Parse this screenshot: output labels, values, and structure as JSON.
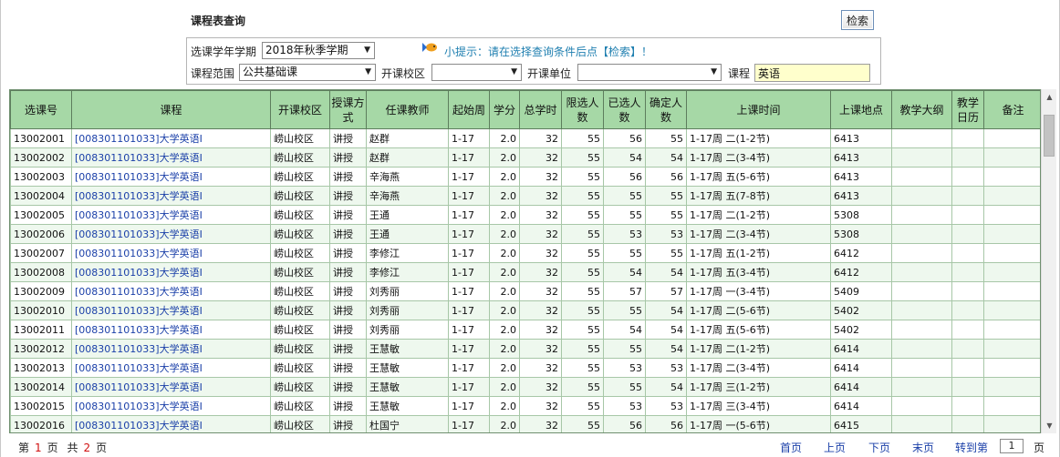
{
  "page": {
    "title": "课程表查询",
    "search_label": "检索"
  },
  "filters": {
    "term_label": "选课学年学期",
    "term_value": "2018年秋季学期",
    "tip": "小提示：请在选择查询条件后点【检索】！",
    "scope_label": "课程范围",
    "scope_value": "公共基础课",
    "campus_label": "开课校区",
    "campus_value": "",
    "unit_label": "开课单位",
    "unit_value": "",
    "course_label": "课程",
    "course_value": "英语"
  },
  "table": {
    "headers": [
      "选课号",
      "课程",
      "开课校区",
      "授课方式",
      "任课教师",
      "起始周",
      "学分",
      "总学时",
      "限选人数",
      "已选人数",
      "确定人数",
      "上课时间",
      "上课地点",
      "教学大纲",
      "教学日历",
      "备注"
    ],
    "rows": [
      [
        "13002001",
        "[008301101033]大学英语Ⅰ",
        "崂山校区",
        "讲授",
        "赵群",
        "1-17",
        "2.0",
        "32",
        "55",
        "56",
        "55",
        "1-17周 二(1-2节)",
        "6413",
        "",
        "",
        ""
      ],
      [
        "13002002",
        "[008301101033]大学英语Ⅰ",
        "崂山校区",
        "讲授",
        "赵群",
        "1-17",
        "2.0",
        "32",
        "55",
        "54",
        "54",
        "1-17周 二(3-4节)",
        "6413",
        "",
        "",
        ""
      ],
      [
        "13002003",
        "[008301101033]大学英语Ⅰ",
        "崂山校区",
        "讲授",
        "辛海燕",
        "1-17",
        "2.0",
        "32",
        "55",
        "56",
        "56",
        "1-17周 五(5-6节)",
        "6413",
        "",
        "",
        ""
      ],
      [
        "13002004",
        "[008301101033]大学英语Ⅰ",
        "崂山校区",
        "讲授",
        "辛海燕",
        "1-17",
        "2.0",
        "32",
        "55",
        "55",
        "55",
        "1-17周 五(7-8节)",
        "6413",
        "",
        "",
        ""
      ],
      [
        "13002005",
        "[008301101033]大学英语Ⅰ",
        "崂山校区",
        "讲授",
        "王通",
        "1-17",
        "2.0",
        "32",
        "55",
        "55",
        "55",
        "1-17周 二(1-2节)",
        "5308",
        "",
        "",
        ""
      ],
      [
        "13002006",
        "[008301101033]大学英语Ⅰ",
        "崂山校区",
        "讲授",
        "王通",
        "1-17",
        "2.0",
        "32",
        "55",
        "53",
        "53",
        "1-17周 二(3-4节)",
        "5308",
        "",
        "",
        ""
      ],
      [
        "13002007",
        "[008301101033]大学英语Ⅰ",
        "崂山校区",
        "讲授",
        "李修江",
        "1-17",
        "2.0",
        "32",
        "55",
        "55",
        "55",
        "1-17周 五(1-2节)",
        "6412",
        "",
        "",
        ""
      ],
      [
        "13002008",
        "[008301101033]大学英语Ⅰ",
        "崂山校区",
        "讲授",
        "李修江",
        "1-17",
        "2.0",
        "32",
        "55",
        "54",
        "54",
        "1-17周 五(3-4节)",
        "6412",
        "",
        "",
        ""
      ],
      [
        "13002009",
        "[008301101033]大学英语Ⅰ",
        "崂山校区",
        "讲授",
        "刘秀丽",
        "1-17",
        "2.0",
        "32",
        "55",
        "57",
        "57",
        "1-17周 一(3-4节)",
        "5409",
        "",
        "",
        ""
      ],
      [
        "13002010",
        "[008301101033]大学英语Ⅰ",
        "崂山校区",
        "讲授",
        "刘秀丽",
        "1-17",
        "2.0",
        "32",
        "55",
        "55",
        "54",
        "1-17周 二(5-6节)",
        "5402",
        "",
        "",
        ""
      ],
      [
        "13002011",
        "[008301101033]大学英语Ⅰ",
        "崂山校区",
        "讲授",
        "刘秀丽",
        "1-17",
        "2.0",
        "32",
        "55",
        "54",
        "54",
        "1-17周 五(5-6节)",
        "5402",
        "",
        "",
        ""
      ],
      [
        "13002012",
        "[008301101033]大学英语Ⅰ",
        "崂山校区",
        "讲授",
        "王慧敏",
        "1-17",
        "2.0",
        "32",
        "55",
        "55",
        "54",
        "1-17周 二(1-2节)",
        "6414",
        "",
        "",
        ""
      ],
      [
        "13002013",
        "[008301101033]大学英语Ⅰ",
        "崂山校区",
        "讲授",
        "王慧敏",
        "1-17",
        "2.0",
        "32",
        "55",
        "53",
        "53",
        "1-17周 二(3-4节)",
        "6414",
        "",
        "",
        ""
      ],
      [
        "13002014",
        "[008301101033]大学英语Ⅰ",
        "崂山校区",
        "讲授",
        "王慧敏",
        "1-17",
        "2.0",
        "32",
        "55",
        "55",
        "54",
        "1-17周 三(1-2节)",
        "6414",
        "",
        "",
        ""
      ],
      [
        "13002015",
        "[008301101033]大学英语Ⅰ",
        "崂山校区",
        "讲授",
        "王慧敏",
        "1-17",
        "2.0",
        "32",
        "55",
        "53",
        "53",
        "1-17周 三(3-4节)",
        "6414",
        "",
        "",
        ""
      ],
      [
        "13002016",
        "[008301101033]大学英语Ⅰ",
        "崂山校区",
        "讲授",
        "杜国宁",
        "1-17",
        "2.0",
        "32",
        "55",
        "56",
        "56",
        "1-17周 一(5-6节)",
        "6415",
        "",
        "",
        ""
      ]
    ]
  },
  "pager": {
    "page_prefix": "第",
    "current_page": "1",
    "page_word": "页",
    "total_prefix": "共",
    "total_pages": "2",
    "total_suffix": "页",
    "first": "首页",
    "prev": "上页",
    "next": "下页",
    "last": "末页",
    "goto_label": "转到第",
    "goto_value": "1",
    "goto_suffix": "页"
  },
  "icons": {
    "tip": "fish-tip-icon"
  },
  "colors": {
    "header_bg": "#a6d8a6",
    "alt_row": "#eef8ee",
    "link": "#1a3fa8",
    "tip": "#1f7fb0",
    "page_num": "#d01010"
  }
}
